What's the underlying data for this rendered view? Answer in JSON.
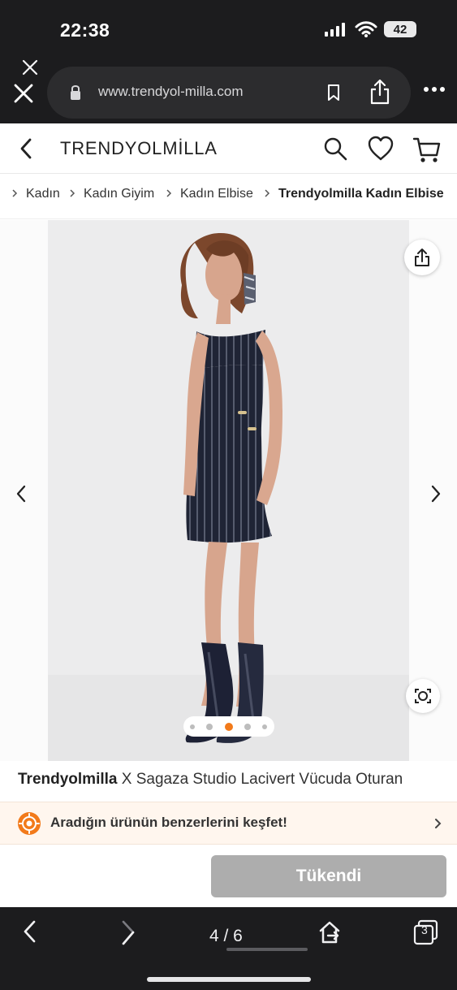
{
  "status_bar": {
    "time": "22:38",
    "battery": "42"
  },
  "browser": {
    "url": "www.trendyol-milla.com"
  },
  "site": {
    "logo": "TRENDYOLMİLLA"
  },
  "breadcrumb": [
    {
      "label": "Kadın"
    },
    {
      "label": "Kadın Giyim"
    },
    {
      "label": "Kadın Elbise"
    },
    {
      "label": "Trendyolmilla Kadın Elbise"
    }
  ],
  "gallery": {
    "active_image_index": 3,
    "image_count": 5
  },
  "product": {
    "brand": "Trendyolmilla",
    "title_rest": " X Sagaza Studio Lacivert Vücuda Oturan"
  },
  "similar_banner": {
    "text": "Aradığın ürünün benzerlerini keşfet!"
  },
  "cta": {
    "sold_out": "Tükendi"
  },
  "toolbar": {
    "page_counter": "4 / 6",
    "tab_count": "3"
  },
  "colors": {
    "accent": "#f27a1a",
    "button_disabled": "#adadad",
    "browser_chrome": "#1c1c1e"
  }
}
